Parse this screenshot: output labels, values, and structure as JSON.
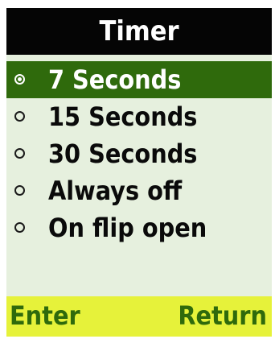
{
  "title": "Timer",
  "menu": {
    "items": [
      {
        "label": "7 Seconds",
        "selected": true
      },
      {
        "label": "15 Seconds",
        "selected": false
      },
      {
        "label": "30 Seconds",
        "selected": false
      },
      {
        "label": "Always off",
        "selected": false
      },
      {
        "label": "On flip open",
        "selected": false
      }
    ]
  },
  "softkeys": {
    "left": "Enter",
    "right": "Return"
  },
  "colors": {
    "title_bg": "#050505",
    "screen_bg": "#e6f0de",
    "highlight": "#2f6a0c",
    "softkey_bg": "#e6f23a",
    "softkey_text": "#2f6a0c"
  }
}
